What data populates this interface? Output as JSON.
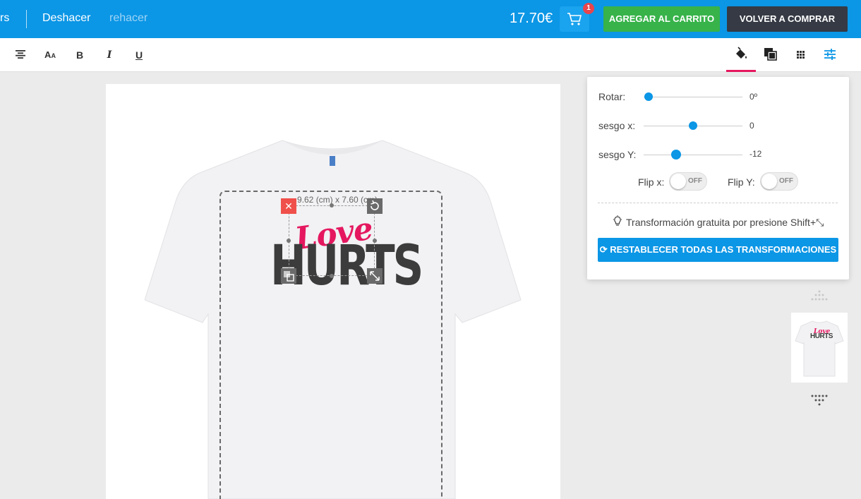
{
  "topbar": {
    "left_cut_text": "rs",
    "undo_label": "Deshacer",
    "redo_label": "rehacer",
    "price": "17.70€",
    "cart_count": "1",
    "add_to_cart_label": "AGREGAR AL CARRITO",
    "buy_again_label": "VOLVER A COMPRAR"
  },
  "toolbar": {
    "text_tools": [
      "align-center-icon",
      "font-size-icon",
      "bold-icon",
      "italic-icon",
      "underline-icon"
    ],
    "bold_glyph": "B",
    "italic_glyph": "I",
    "underline_glyph": "U",
    "right_tools": [
      "fill-color-icon",
      "stroke-color-icon",
      "pattern-icon",
      "transform-settings-icon"
    ],
    "active_color": "#e5175f",
    "accent_color": "#0b96e6"
  },
  "design": {
    "dimensions": "9.62 (cm) x 7.60 (cm)",
    "word1": "Love",
    "word2": "HURTS",
    "word1_color": "#e5175f",
    "word2_color": "#3c3c3c"
  },
  "panel": {
    "rotate_label": "Rotar:",
    "rotate_value": "0º",
    "skew_x_label": "sesgo x:",
    "skew_x_value": "0",
    "skew_y_label": "sesgo Y:",
    "skew_y_value": "-12",
    "flip_x_label": "Flip x:",
    "flip_y_label": "Flip Y:",
    "flip_x_state": "OFF",
    "flip_y_state": "OFF",
    "tip_text": "Transformación gratuita por presione Shift+⤡",
    "reset_label": "RESTABLECER TODAS LAS TRANSFORMACIONES"
  },
  "thumbnail": {
    "word1": "Love",
    "word2": "HURTS"
  }
}
